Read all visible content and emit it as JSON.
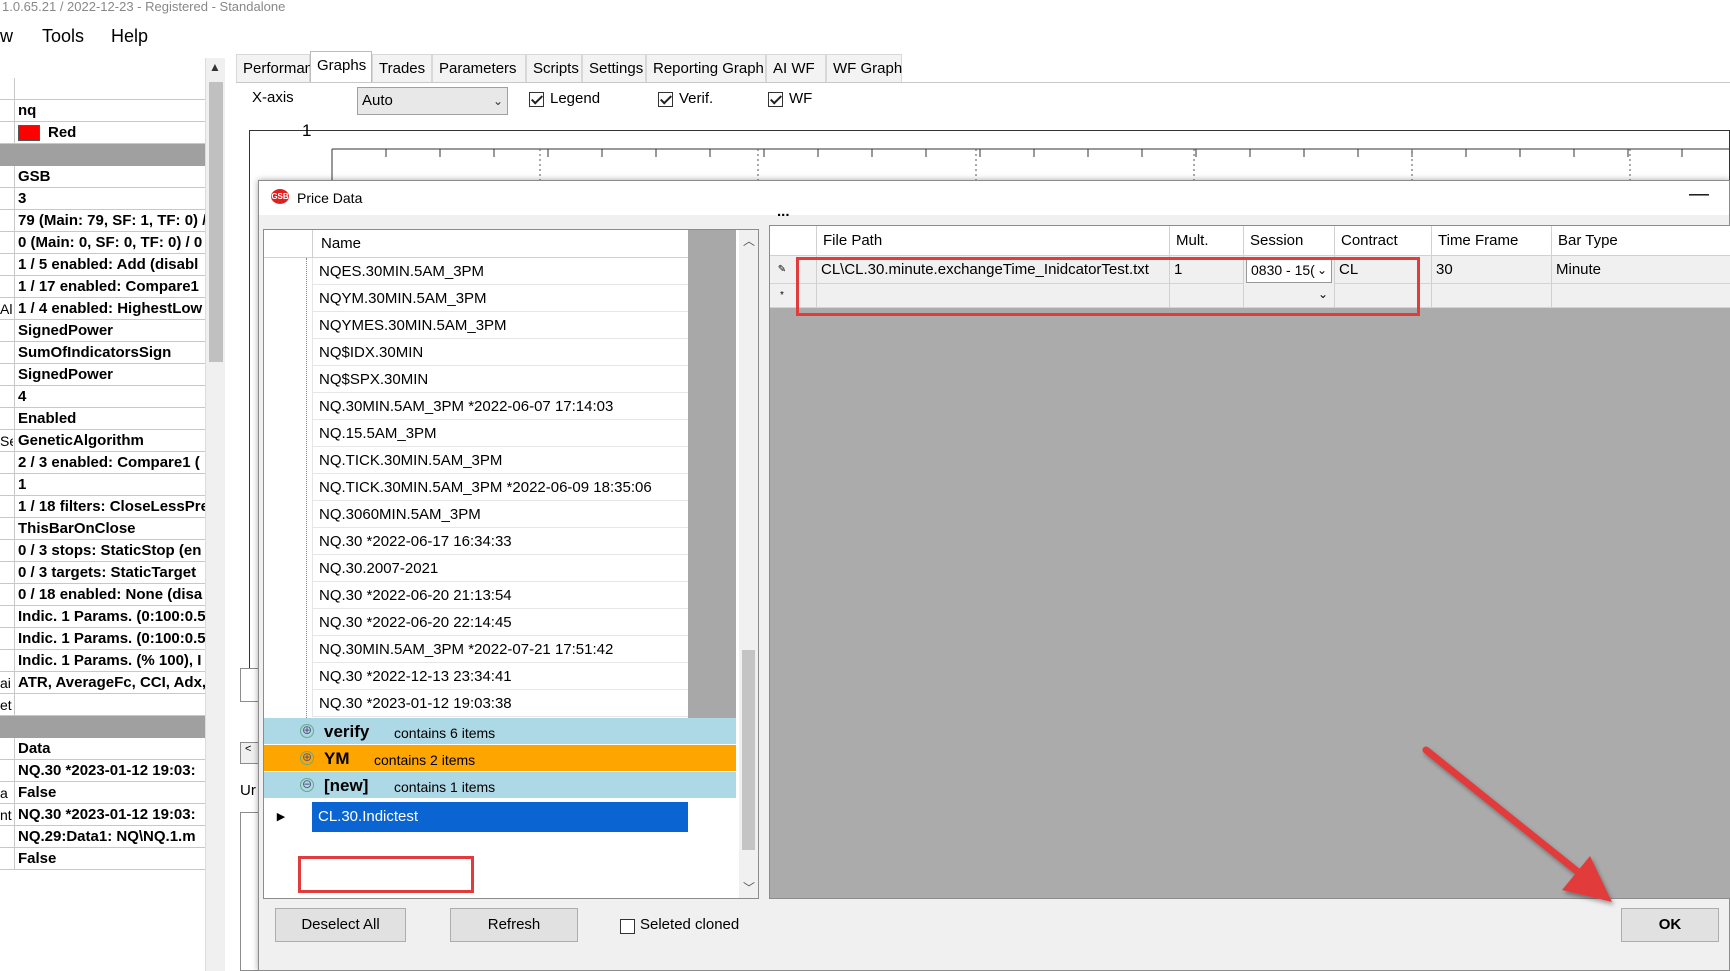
{
  "window": {
    "title": "1.0.65.21 / 2022-12-23 - Registered - Standalone"
  },
  "menu": [
    "w",
    "Tools",
    "Help"
  ],
  "left_panel": {
    "rows": [
      {
        "label": "",
        "value": "",
        "cat": false
      },
      {
        "label": "",
        "value": "nq",
        "cat": false
      },
      {
        "label": "",
        "value": "Red",
        "cat": false,
        "swatch": "#ff0000"
      },
      {
        "label": "",
        "value": "",
        "cat": true
      },
      {
        "label": "",
        "value": "GSB",
        "cat": false
      },
      {
        "label": "",
        "value": "3",
        "cat": false
      },
      {
        "label": "",
        "value": "79 (Main: 79, SF: 1, TF: 0) /",
        "cat": false
      },
      {
        "label": "",
        "value": "0 (Main: 0, SF: 0, TF: 0) / 0",
        "cat": false
      },
      {
        "label": "",
        "value": "1 / 5 enabled: Add (disabl",
        "cat": false
      },
      {
        "label": "",
        "value": "1 / 17 enabled: Compare1",
        "cat": false
      },
      {
        "label": "Al",
        "value": "1 / 4 enabled: HighestLow",
        "cat": false
      },
      {
        "label": "",
        "value": "SignedPower",
        "cat": false
      },
      {
        "label": "",
        "value": "SumOfIndicatorsSign",
        "cat": false
      },
      {
        "label": "",
        "value": "SignedPower",
        "cat": false
      },
      {
        "label": "",
        "value": "4",
        "cat": false
      },
      {
        "label": "",
        "value": "Enabled",
        "cat": false
      },
      {
        "label": "Se",
        "value": "GeneticAlgorithm",
        "cat": false
      },
      {
        "label": "",
        "value": "2 / 3 enabled: Compare1 (",
        "cat": false
      },
      {
        "label": "",
        "value": "1",
        "cat": false
      },
      {
        "label": "",
        "value": "1 / 18 filters: CloseLessPre",
        "cat": false
      },
      {
        "label": "",
        "value": "ThisBarOnClose",
        "cat": false
      },
      {
        "label": "",
        "value": "0 / 3 stops: StaticStop (en",
        "cat": false
      },
      {
        "label": "",
        "value": "0 / 3 targets: StaticTarget",
        "cat": false
      },
      {
        "label": "",
        "value": "0 / 18 enabled: None (disa",
        "cat": false
      },
      {
        "label": "",
        "value": "Indic. 1 Params. (0:100:0.5",
        "cat": false
      },
      {
        "label": "",
        "value": "Indic. 1 Params. (0:100:0.5",
        "cat": false
      },
      {
        "label": "",
        "value": "Indic. 1 Params. (% 100), I",
        "cat": false
      },
      {
        "label": "ai",
        "value": "ATR, AverageFc, CCI, Adx,",
        "cat": false
      },
      {
        "label": "et",
        "value": "",
        "cat": false
      },
      {
        "label": "",
        "value": "",
        "cat": true
      },
      {
        "label": "",
        "value": "Data",
        "cat": false
      },
      {
        "label": "",
        "value": "NQ.30 *2023-01-12 19:03:",
        "cat": false
      },
      {
        "label": "a",
        "value": "False",
        "cat": false
      },
      {
        "label": "nt",
        "value": "NQ.30 *2023-01-12 19:03:",
        "cat": false
      },
      {
        "label": "",
        "value": "NQ.29:Data1: NQ\\NQ.1.m",
        "cat": false
      },
      {
        "label": "",
        "value": "False",
        "cat": false
      }
    ]
  },
  "tabs": [
    "Performance",
    "Graphs",
    "Trades",
    "Parameters",
    "Scripts",
    "Settings",
    "Reporting Graph",
    "AI WF",
    "WF Graph"
  ],
  "active_tab": "Graphs",
  "graph_settings": {
    "xaxis_label": "X-axis",
    "xaxis_value": "Auto",
    "legend_label": "Legend",
    "verif_label": "Verif.",
    "wf_label": "WF",
    "chart_top_label": "1"
  },
  "behind": {
    "un_label": "Ur"
  },
  "dialog": {
    "title": "Price Data",
    "minimize": "—",
    "tree_header": "Name",
    "tree_items": [
      "NQES.30MIN.5AM_3PM",
      "NQYM.30MIN.5AM_3PM",
      "NQYMES.30MIN.5AM_3PM",
      "NQ$IDX.30MIN",
      "NQ$SPX.30MIN",
      "NQ.30MIN.5AM_3PM  *2022-06-07 17:14:03",
      "NQ.15.5AM_3PM",
      "NQ.TICK.30MIN.5AM_3PM",
      "NQ.TICK.30MIN.5AM_3PM *2022-06-09 18:35:06",
      "NQ.3060MIN.5AM_3PM",
      "NQ.30 *2022-06-17 16:34:33",
      "NQ.30.2007-2021",
      "NQ.30 *2022-06-20 21:13:54",
      "NQ.30 *2022-06-20 22:14:45",
      "NQ.30MIN.5AM_3PM  *2022-07-21 17:51:42",
      "NQ.30 *2022-12-13 23:34:41",
      "NQ.30 *2023-01-12 19:03:38"
    ],
    "groups": [
      {
        "name": "verify",
        "count": "contains 6 items",
        "color": "#add8e6",
        "toggle": "⊕"
      },
      {
        "name": "YM",
        "count": "contains 2 items",
        "color": "#ffa500",
        "toggle": "⊕"
      },
      {
        "name": "[new]",
        "count": "contains 1 items",
        "color": "#add8e6",
        "toggle": "⊖"
      }
    ],
    "selected_item": "CL.30.Indictest",
    "selected_marker": "▶",
    "grid": {
      "ellipsis": "...",
      "columns": [
        "File Path",
        "Mult.",
        "Session",
        "Contract",
        "Time Frame",
        "Bar Type"
      ],
      "row": {
        "marker": "✎",
        "file_path": "CL\\CL.30.minute.exchangeTime_InidcatorTest.txt",
        "mult": "1",
        "session": "0830 - 15(",
        "contract": "CL",
        "time_frame": "30",
        "bar_type": "Minute"
      },
      "new_row_marker": "*"
    },
    "buttons": {
      "deselect_all": "Deselect All",
      "refresh": "Refresh",
      "selected_cloned": "Seleted cloned",
      "ok": "OK"
    }
  },
  "colors": {
    "highlight": "#e23b3b",
    "selection": "#0a64d2",
    "group_blue": "#add8e6",
    "group_orange": "#ffa500"
  }
}
